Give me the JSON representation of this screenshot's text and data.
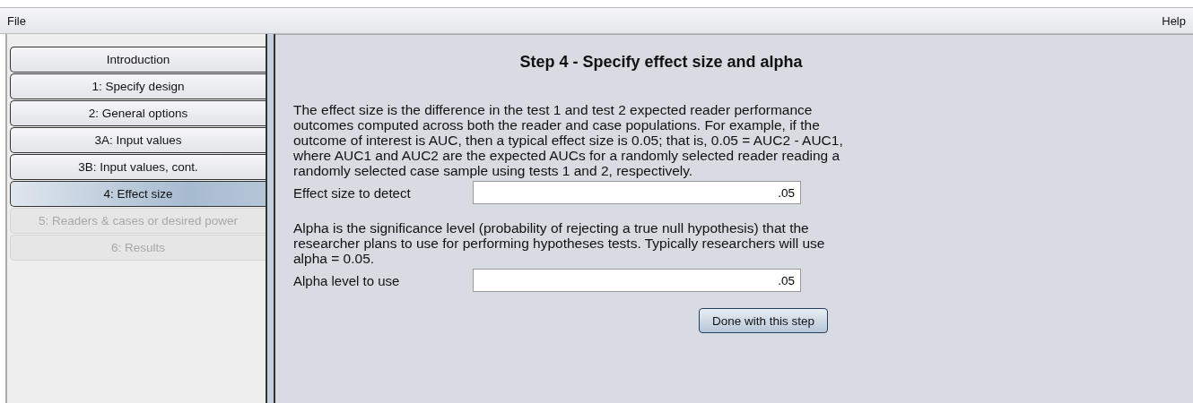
{
  "menu_bar": {
    "left": "File",
    "right": "Help"
  },
  "steps": [
    {
      "label": "Introduction",
      "selected": false,
      "disabled": false
    },
    {
      "label": "1: Specify design",
      "selected": false,
      "disabled": false
    },
    {
      "label": "2: General options",
      "selected": false,
      "disabled": false
    },
    {
      "label": "3A: Input values",
      "selected": false,
      "disabled": false
    },
    {
      "label": "3B: Input values, cont.",
      "selected": false,
      "disabled": false
    },
    {
      "label": "4: Effect size",
      "selected": true,
      "disabled": false
    },
    {
      "label": "5: Readers & cases or desired power",
      "selected": false,
      "disabled": true
    },
    {
      "label": "6: Results",
      "selected": false,
      "disabled": true
    }
  ],
  "content": {
    "title": "Step 4 - Specify effect size and alpha",
    "sections": [
      {
        "description": "The effect size is the difference in the test 1 and test 2 expected reader performance outcomes computed across both the reader and case populations.  For example, if the outcome of interest is AUC, then a typical effect size is 0.05; that is, 0.05 = AUC2 - AUC1, where AUC1 and AUC2 are the expected AUCs for a randomly selected reader reading a randomly selected case sample using tests 1 and 2, respectively.",
        "field_label": "Effect size to detect",
        "value": ".05"
      },
      {
        "description": "Alpha is the significance level (probability of rejecting a true null hypothesis) that the researcher plans to use for performing hypotheses tests.  Typically researchers will use alpha = 0.05.",
        "field_label": "Alpha level to use",
        "value": ".05"
      }
    ],
    "button": "Done with this step"
  }
}
